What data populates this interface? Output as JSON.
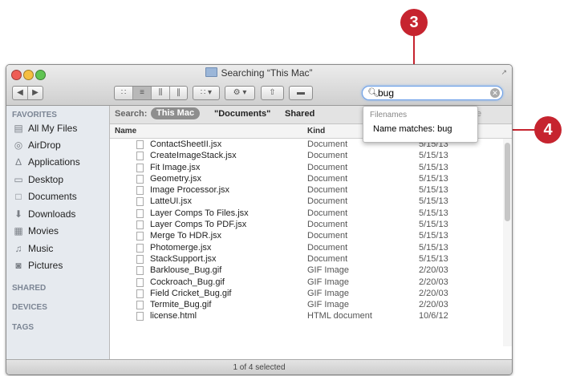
{
  "window": {
    "title": "Searching “This Mac”"
  },
  "toolbar": {
    "search_value": "bug"
  },
  "scopebar": {
    "label": "Search:",
    "scope_this_mac": "This Mac",
    "scope_documents": "\"Documents\"",
    "scope_shared": "Shared",
    "save_label": "Save"
  },
  "search_dropdown": {
    "header": "Filenames",
    "item": "Name matches: bug"
  },
  "sidebar": {
    "favorites_header": "FAVORITES",
    "items": [
      {
        "label": "All My Files",
        "icon": "all-my-files-icon"
      },
      {
        "label": "AirDrop",
        "icon": "airdrop-icon"
      },
      {
        "label": "Applications",
        "icon": "applications-icon"
      },
      {
        "label": "Desktop",
        "icon": "desktop-icon"
      },
      {
        "label": "Documents",
        "icon": "documents-icon"
      },
      {
        "label": "Downloads",
        "icon": "downloads-icon"
      },
      {
        "label": "Movies",
        "icon": "movies-icon"
      },
      {
        "label": "Music",
        "icon": "music-icon"
      },
      {
        "label": "Pictures",
        "icon": "pictures-icon"
      }
    ],
    "shared_header": "SHARED",
    "devices_header": "DEVICES",
    "tags_header": "TAGS"
  },
  "columns": {
    "name": "Name",
    "kind": "Kind"
  },
  "files": [
    {
      "name": "ContactSheetII.jsx",
      "kind": "Document",
      "date": "5/15/13"
    },
    {
      "name": "CreateImageStack.jsx",
      "kind": "Document",
      "date": "5/15/13"
    },
    {
      "name": "Fit Image.jsx",
      "kind": "Document",
      "date": "5/15/13"
    },
    {
      "name": "Geometry.jsx",
      "kind": "Document",
      "date": "5/15/13"
    },
    {
      "name": "Image Processor.jsx",
      "kind": "Document",
      "date": "5/15/13"
    },
    {
      "name": "LatteUI.jsx",
      "kind": "Document",
      "date": "5/15/13"
    },
    {
      "name": "Layer Comps To Files.jsx",
      "kind": "Document",
      "date": "5/15/13"
    },
    {
      "name": "Layer Comps To PDF.jsx",
      "kind": "Document",
      "date": "5/15/13"
    },
    {
      "name": "Merge To HDR.jsx",
      "kind": "Document",
      "date": "5/15/13"
    },
    {
      "name": "Photomerge.jsx",
      "kind": "Document",
      "date": "5/15/13"
    },
    {
      "name": "StackSupport.jsx",
      "kind": "Document",
      "date": "5/15/13"
    },
    {
      "name": "Barklouse_Bug.gif",
      "kind": "GIF Image",
      "date": "2/20/03"
    },
    {
      "name": "Cockroach_Bug.gif",
      "kind": "GIF Image",
      "date": "2/20/03"
    },
    {
      "name": "Field Cricket_Bug.gif",
      "kind": "GIF Image",
      "date": "2/20/03"
    },
    {
      "name": "Termite_Bug.gif",
      "kind": "GIF Image",
      "date": "2/20/03"
    },
    {
      "name": "license.html",
      "kind": "HTML document",
      "date": "10/6/12"
    }
  ],
  "status": {
    "text": "1 of 4 selected"
  },
  "callouts": {
    "search_step": "3",
    "dropdown_step": "4"
  },
  "colors": {
    "callout": "#c6242f",
    "sidebar": "#e6eaef",
    "search_focus": "#6a9ee8"
  }
}
